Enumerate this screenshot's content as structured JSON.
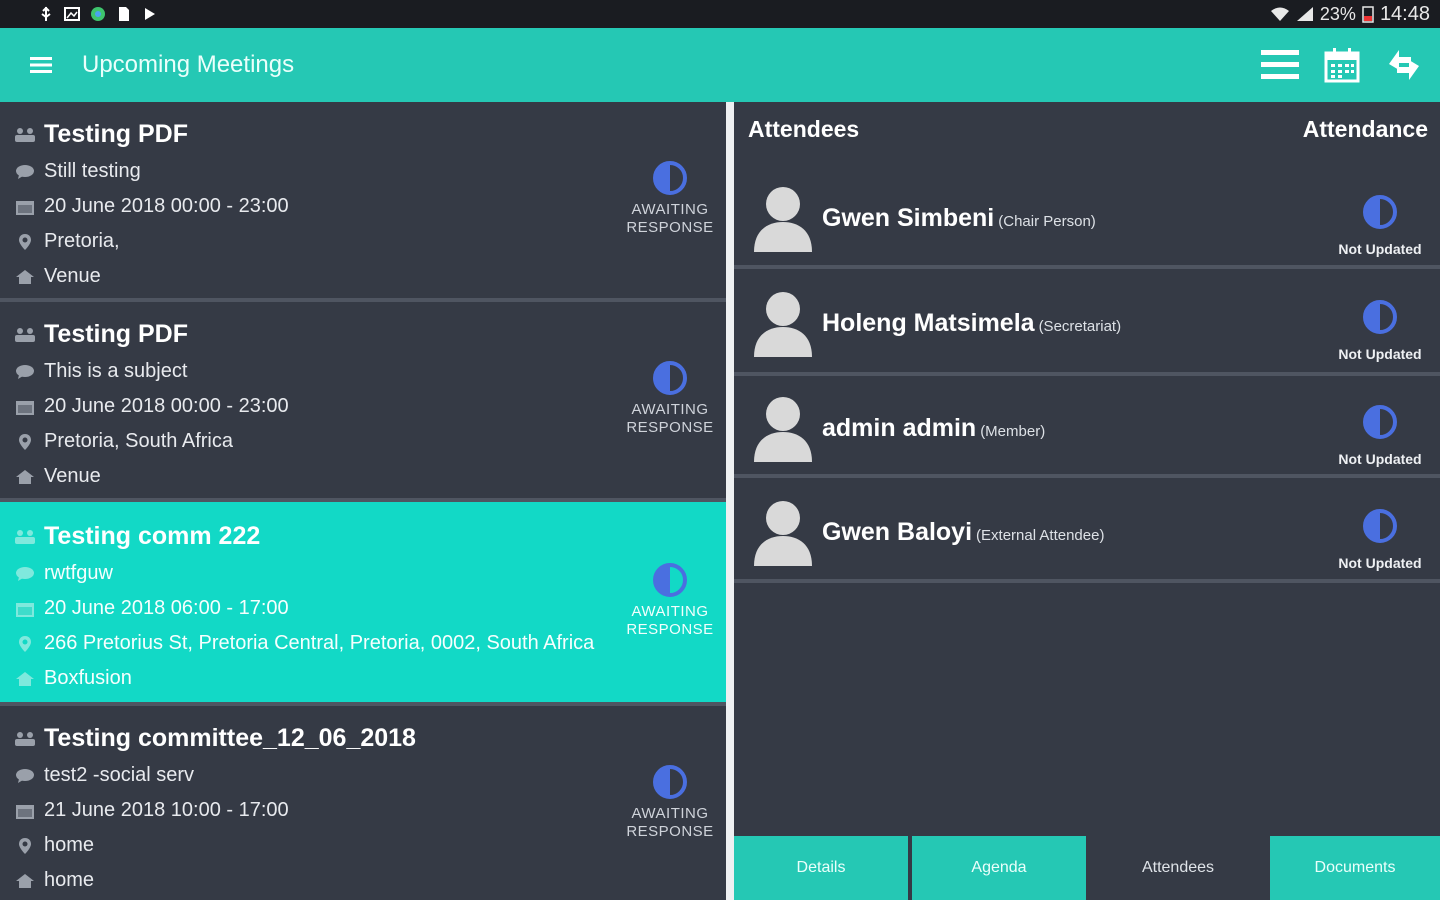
{
  "status_bar": {
    "battery": "23%",
    "time": "14:48"
  },
  "app_bar": {
    "title": "Upcoming Meetings"
  },
  "meetings": [
    {
      "title": "Testing PDF",
      "subject": "Still testing",
      "date": "20 June 2018 00:00  -  23:00",
      "location": "Pretoria,",
      "venue": "Venue",
      "status": "AWAITING RESPONSE",
      "selected": false
    },
    {
      "title": "Testing PDF",
      "subject": "This is  a subject",
      "date": "20 June 2018 00:00  -  23:00",
      "location": "Pretoria, South Africa",
      "venue": "Venue",
      "status": "AWAITING RESPONSE",
      "selected": false
    },
    {
      "title": "Testing comm 222",
      "subject": "rwtfguw",
      "date": "20 June 2018 06:00  -  17:00",
      "location": "266 Pretorius St, Pretoria Central, Pretoria, 0002, South Africa",
      "venue": "Boxfusion",
      "status": "AWAITING RESPONSE",
      "selected": true
    },
    {
      "title": "Testing committee_12_06_2018",
      "subject": "test2 -social serv",
      "date": "21 June 2018 10:00  -  17:00",
      "location": "home",
      "venue": "home",
      "status": "AWAITING RESPONSE",
      "selected": false
    }
  ],
  "attendees_panel": {
    "header_left": "Attendees",
    "header_right": "Attendance",
    "attendees": [
      {
        "name": "Gwen Simbeni",
        "role": "(Chair Person)",
        "attendance": "Not Updated"
      },
      {
        "name": "Holeng Matsimela",
        "role": "(Secretariat)",
        "attendance": "Not Updated"
      },
      {
        "name": "admin admin",
        "role": "(Member)",
        "attendance": "Not Updated"
      },
      {
        "name": "Gwen Baloyi",
        "role": "(External Attendee)",
        "attendance": "Not Updated"
      }
    ]
  },
  "tabs": [
    {
      "label": "Details",
      "active": false
    },
    {
      "label": "Agenda",
      "active": false
    },
    {
      "label": "Attendees",
      "active": true
    },
    {
      "label": "Documents",
      "active": false
    }
  ],
  "colors": {
    "accent": "#25c8b4",
    "selected": "#12d9c6",
    "background": "#353a45",
    "status_icon": "#4a6fe0"
  }
}
